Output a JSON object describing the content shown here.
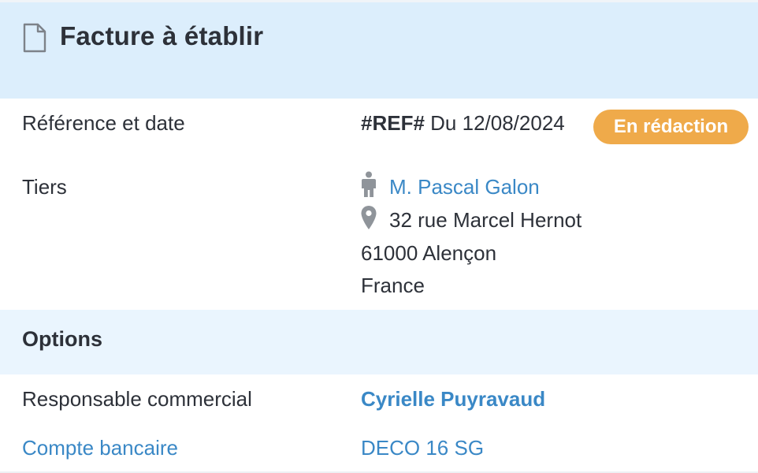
{
  "header": {
    "title": "Facture à établir",
    "icon": "document-icon"
  },
  "fields": {
    "reference_label": "Référence et date",
    "reference_code": "#REF#",
    "reference_date": "Du 12/08/2024",
    "status_badge": "En rédaction",
    "tiers_label": "Tiers",
    "tiers_name": "M. Pascal Galon",
    "tiers_address_line1": "32 rue Marcel Hernot",
    "tiers_address_line2": "61000 Alençon",
    "tiers_country": "France"
  },
  "options": {
    "section_title": "Options",
    "sales_rep_label": "Responsable commercial",
    "sales_rep_value": "Cyrielle Puyravaud",
    "bank_account_label": "Compte bancaire",
    "bank_account_value": "DECO 16 SG"
  },
  "colors": {
    "header_bg": "#dceefc",
    "section_bg": "#eaf5fe",
    "link": "#3a88c6",
    "badge": "#efaa4a",
    "text": "#2d3139"
  }
}
